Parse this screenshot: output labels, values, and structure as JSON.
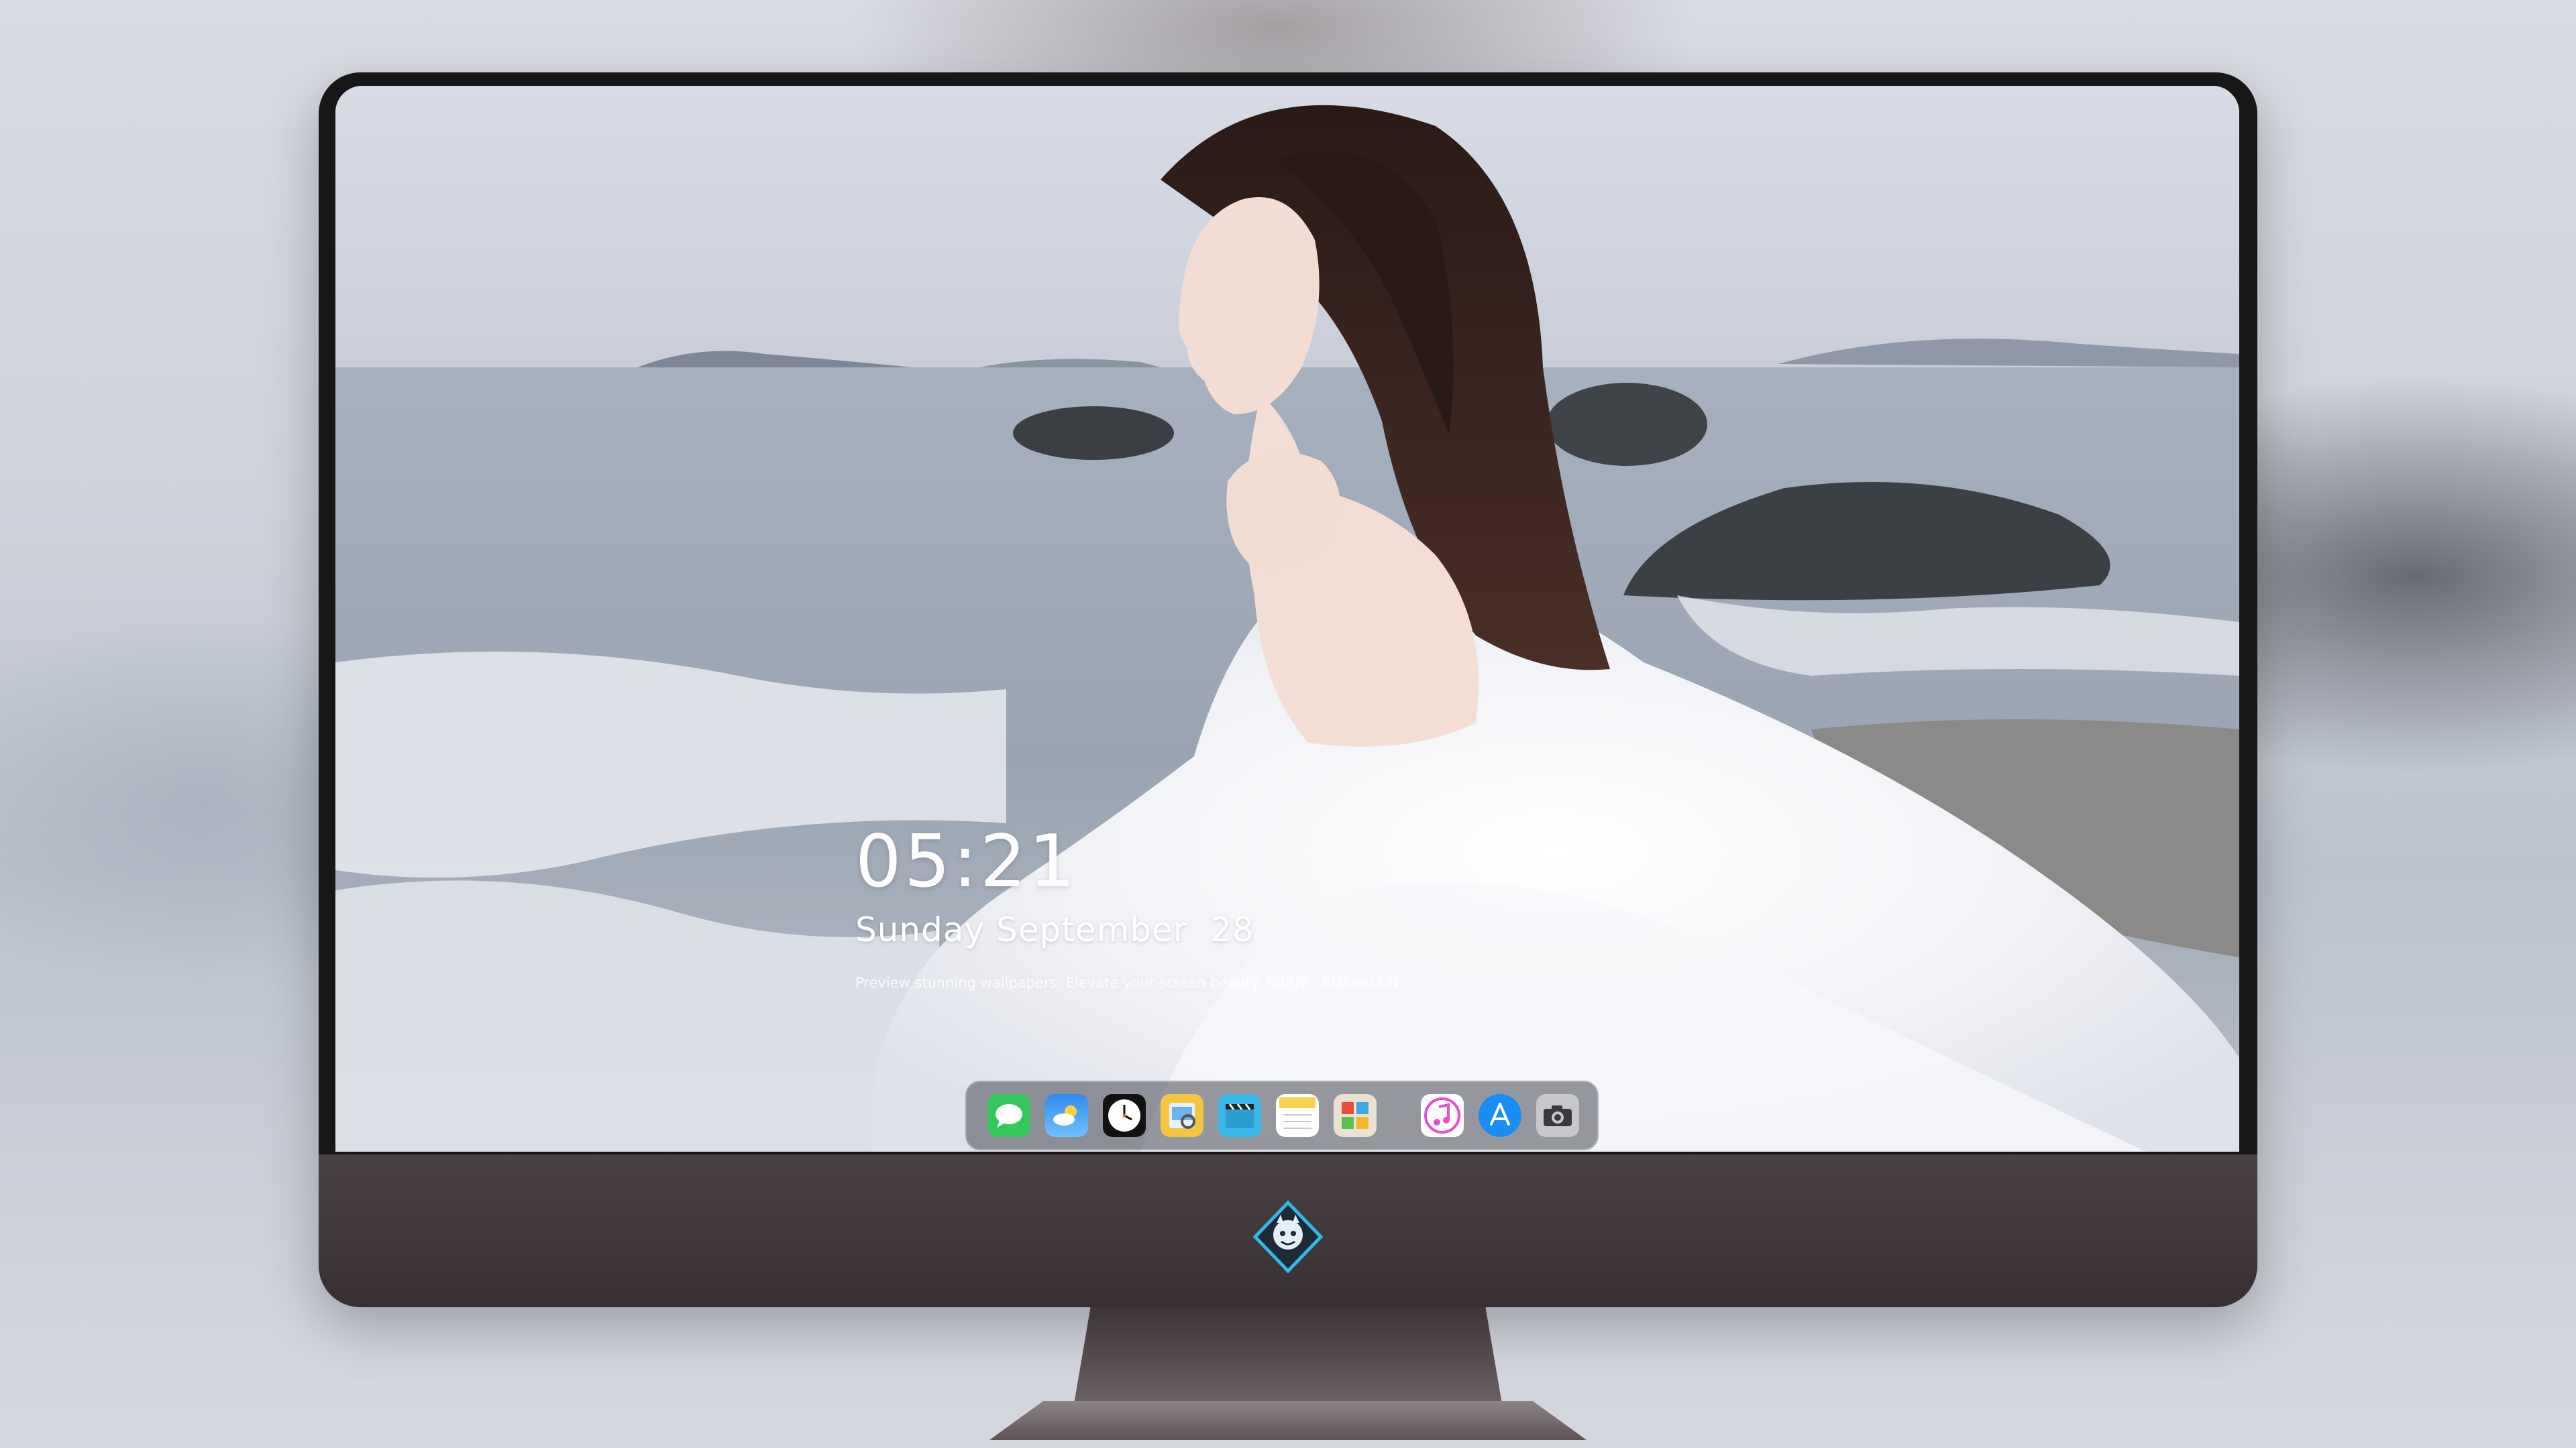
{
  "lockscreen": {
    "time": "05:21",
    "date": "Sunday September  28",
    "caption": "Preview stunning wallpapers. Elevate your screen beauty. 壁纸库 · Bizhimi.CN"
  },
  "dock": {
    "apps": [
      {
        "name": "messages-icon",
        "color": "#34c759"
      },
      {
        "name": "weather-icon",
        "color": "#2f8bf0"
      },
      {
        "name": "clock-icon",
        "color": "#111111"
      },
      {
        "name": "preview-icon",
        "color": "#f5c542"
      },
      {
        "name": "clips-icon",
        "color": "#38b7e8"
      },
      {
        "name": "notes-icon",
        "color": "#f8d24a"
      },
      {
        "name": "photo-booth-icon",
        "color": "#e9e2d2"
      },
      {
        "name": "itunes-icon",
        "color": "#e94bd3"
      },
      {
        "name": "app-store-icon",
        "color": "#1a8cf5"
      },
      {
        "name": "camera-icon",
        "color": "#7d7d82"
      }
    ]
  },
  "colors": {
    "monitor_bezel": "#171718",
    "monitor_chin": "#43393d",
    "accent_logo": "#2fb8e8"
  }
}
